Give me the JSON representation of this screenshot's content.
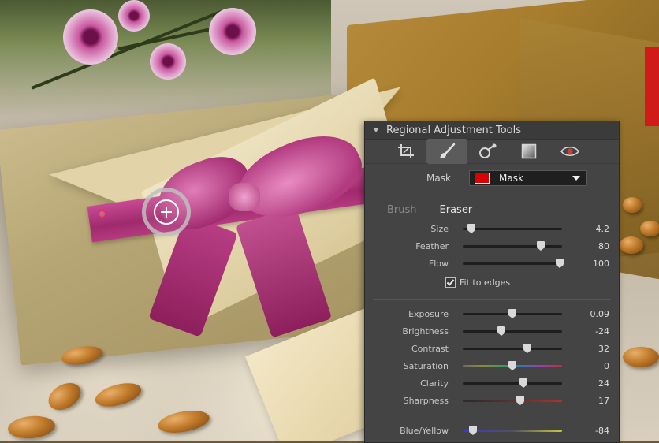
{
  "panel": {
    "title": "Regional Adjustment Tools",
    "tools": [
      {
        "name": "crop-icon",
        "active": false
      },
      {
        "name": "brush-icon",
        "active": true
      },
      {
        "name": "radial-filter-icon",
        "active": false
      },
      {
        "name": "graduated-filter-icon",
        "active": false
      },
      {
        "name": "eye-icon",
        "active": false
      }
    ],
    "mask": {
      "label": "Mask",
      "value": "Mask",
      "swatch_color": "#d90000"
    },
    "modes": {
      "brush": "Brush",
      "eraser": "Eraser",
      "active": "Eraser"
    },
    "brush_sliders": [
      {
        "label": "Size",
        "value": "4.2",
        "pos": 0.07
      },
      {
        "label": "Feather",
        "value": "80",
        "pos": 0.8
      },
      {
        "label": "Flow",
        "value": "100",
        "pos": 1.0
      }
    ],
    "fit_to_edges": {
      "label": "Fit to edges",
      "checked": true
    },
    "adjustments": [
      {
        "label": "Exposure",
        "value": "0.09",
        "pos": 0.5,
        "track": "plain"
      },
      {
        "label": "Brightness",
        "value": "-24",
        "pos": 0.38,
        "track": "plain"
      },
      {
        "label": "Contrast",
        "value": "32",
        "pos": 0.66,
        "track": "plain"
      },
      {
        "label": "Saturation",
        "value": "0",
        "pos": 0.5,
        "track": "saturation"
      },
      {
        "label": "Clarity",
        "value": "24",
        "pos": 0.62,
        "track": "plain"
      },
      {
        "label": "Sharpness",
        "value": "17",
        "pos": 0.58,
        "track": "sharpness"
      }
    ],
    "color_sliders": [
      {
        "label": "Blue/Yellow",
        "value": "-84",
        "pos": 0.08,
        "track": "blue-yellow"
      }
    ]
  }
}
